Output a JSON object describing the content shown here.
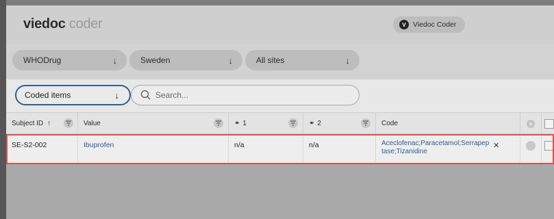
{
  "app": {
    "logo_bold": "viedoc",
    "logo_light": "coder"
  },
  "user": {
    "avatar_letter": "V",
    "name": "Viedoc Coder"
  },
  "filters": {
    "dictionary": "WHODrug",
    "country": "Sweden",
    "site": "All sites"
  },
  "toolbar": {
    "view_select": "Coded items",
    "search_placeholder": "Search..."
  },
  "table": {
    "headers": {
      "subject_id": "Subject ID",
      "value": "Value",
      "attr1": "1",
      "attr2": "2",
      "code": "Code"
    },
    "rows": [
      {
        "subject_id": "SE-S2-002",
        "value": "Ibuprofen",
        "attr1": "n/a",
        "attr2": "n/a",
        "code": "Aceclofenac;Paracetamol;Serrapeptase;Tizanidine"
      }
    ]
  },
  "colors": {
    "accent": "#2d5f95",
    "link": "#2c5d8f",
    "highlight": "#d9534f"
  },
  "icons": {
    "arrow": "down-arrow-icon",
    "search": "search-icon",
    "sort": "sort-up-icon",
    "filter": "filter-icon",
    "link": "link-icon",
    "remove": "close-icon",
    "gear": "gear-icon"
  }
}
